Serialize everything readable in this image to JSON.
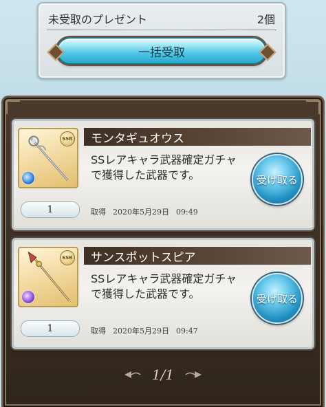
{
  "header": {
    "title": "未受取のプレゼント",
    "count": "2個",
    "receive_all_label": "一括受取"
  },
  "presents": [
    {
      "name": "モンタギュオウス",
      "rarity": "SSR",
      "element": "water",
      "description": "SSレアキャラ武器確定ガチャで獲得した武器です。",
      "quantity": "1",
      "acquired_label": "取得",
      "date": "2020年5月29日",
      "time": "09:49",
      "receive_label": "受け取る"
    },
    {
      "name": "サンスポットスピア",
      "rarity": "SSR",
      "element": "dark",
      "description": "SSレアキャラ武器確定ガチャで獲得した武器です。",
      "quantity": "1",
      "acquired_label": "取得",
      "date": "2020年5月29日",
      "time": "09:47",
      "receive_label": "受け取る"
    }
  ],
  "pagination": {
    "label": "1/1"
  }
}
